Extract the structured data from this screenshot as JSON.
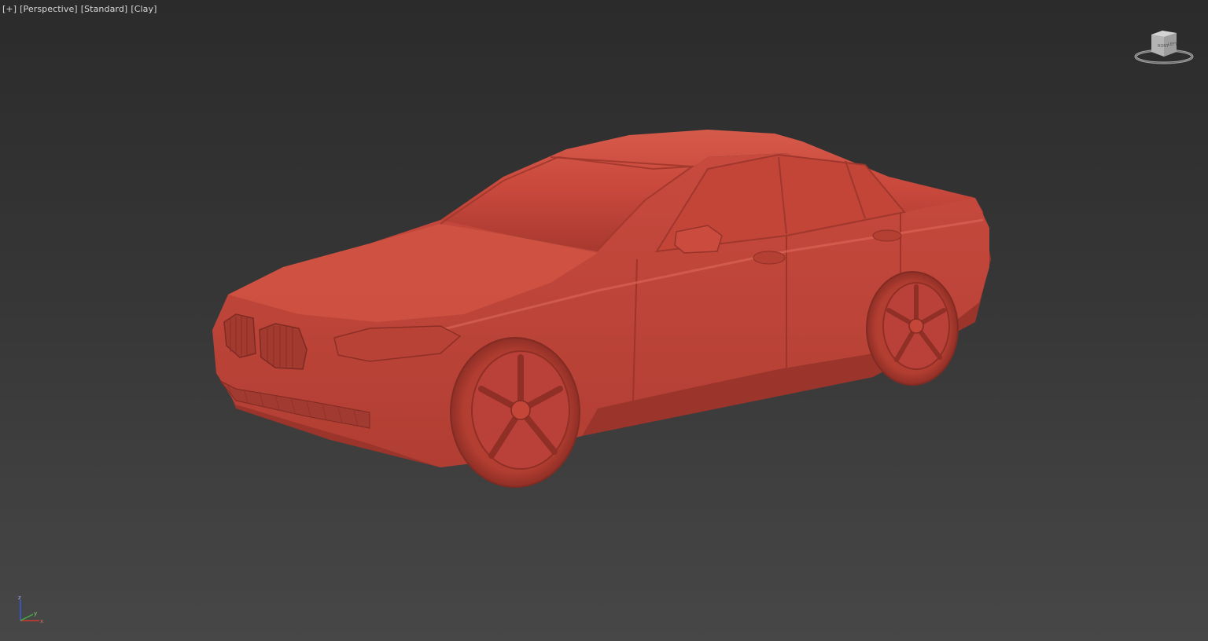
{
  "viewport": {
    "labels": {
      "menu": "[+]",
      "view": "[Perspective]",
      "shading": "[Standard]",
      "material": "[Clay]"
    },
    "background_top": "#2b2b2b",
    "background_bottom": "#474747",
    "model_color": "#c8483c",
    "icons": {
      "viewcube": "viewcube-icon",
      "axis": "axis-tripod-icon"
    },
    "axis_labels": {
      "z": "z",
      "x": "x",
      "y": "y"
    }
  }
}
